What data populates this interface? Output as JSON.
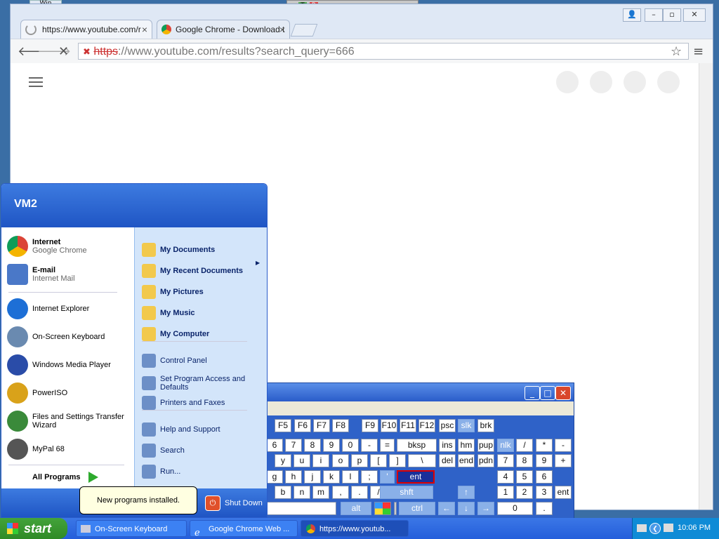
{
  "desktop": {
    "top_label": "Win"
  },
  "browser": {
    "tabs": [
      {
        "label": "https://www.youtube.com/r"
      },
      {
        "label": "Google Chrome - Download t"
      }
    ],
    "url_scheme": "https",
    "url_rest": "://www.youtube.com/results?search_query=666",
    "page_bg": "#ffffff"
  },
  "osk": {
    "title": "On-Screen Keyboard",
    "row_fn": [
      "F5",
      "F6",
      "F7",
      "F8",
      "F9",
      "F10",
      "F11",
      "F12",
      "psc",
      "slk",
      "brk"
    ],
    "row_num": [
      "6",
      "7",
      "8",
      "9",
      "0",
      "-",
      "=",
      "bksp",
      "ins",
      "hm",
      "pup",
      "nlk",
      "/",
      "*",
      "-"
    ],
    "row_q": [
      "y",
      "u",
      "i",
      "o",
      "p",
      "[",
      "]",
      "\\",
      "del",
      "end",
      "pdn",
      "7",
      "8",
      "9",
      "+"
    ],
    "row_a": [
      "g",
      "h",
      "j",
      "k",
      "l",
      ";",
      "'",
      "ent",
      "4",
      "5",
      "6"
    ],
    "row_z": [
      "b",
      "n",
      "m",
      ",",
      ".",
      "/",
      "shft",
      "1",
      "2",
      "3",
      "ent"
    ],
    "row_sp": [
      "alt",
      "ctrl",
      "0",
      "."
    ]
  },
  "startmenu": {
    "user": "VM2",
    "pinned": [
      {
        "title": "Internet",
        "sub": "Google Chrome",
        "icon": "chrome-icon",
        "color": "#db4437"
      },
      {
        "title": "E-mail",
        "sub": "Internet Mail",
        "icon": "email-icon",
        "color": "#4a78c8"
      }
    ],
    "recent": [
      {
        "label": "Internet Explorer",
        "icon": "ie-icon",
        "color": "#1d6fd6"
      },
      {
        "label": "On-Screen Keyboard",
        "icon": "keyboard-icon",
        "color": "#6a8ab0"
      },
      {
        "label": "Windows Media Player",
        "icon": "media-player-icon",
        "color": "#2a4ca8"
      },
      {
        "label": "PowerISO",
        "icon": "poweriso-icon",
        "color": "#d9a21a"
      },
      {
        "label": "Files and Settings Transfer Wizard",
        "icon": "transfer-wizard-icon",
        "color": "#3a8a3a"
      },
      {
        "label": "MyPal 68",
        "icon": "mypal-icon",
        "color": "#555555"
      }
    ],
    "all_programs": "All Programs",
    "right_bold": [
      {
        "label": "My Documents",
        "icon": "folder-icon"
      },
      {
        "label": "My Recent Documents",
        "icon": "recent-docs-icon"
      },
      {
        "label": "My Pictures",
        "icon": "pictures-folder-icon"
      },
      {
        "label": "My Music",
        "icon": "music-folder-icon"
      },
      {
        "label": "My Computer",
        "icon": "computer-icon"
      }
    ],
    "right_sys": [
      {
        "label": "Control Panel",
        "icon": "control-panel-icon"
      },
      {
        "label": "Set Program Access and Defaults",
        "icon": "program-access-icon"
      },
      {
        "label": "Printers and Faxes",
        "icon": "printer-icon"
      }
    ],
    "right_help": [
      {
        "label": "Help and Support",
        "icon": "help-icon"
      },
      {
        "label": "Search",
        "icon": "search-icon"
      },
      {
        "label": "Run...",
        "icon": "run-icon"
      }
    ],
    "shutdown": "Shut Down"
  },
  "balloon": "New programs installed.",
  "taskbar": {
    "start": "start",
    "buttons": [
      {
        "label": "On-Screen Keyboard"
      },
      {
        "label": "Google Chrome Web ..."
      },
      {
        "label": "https://www.youtub..."
      }
    ],
    "clock": "10:06 PM"
  }
}
